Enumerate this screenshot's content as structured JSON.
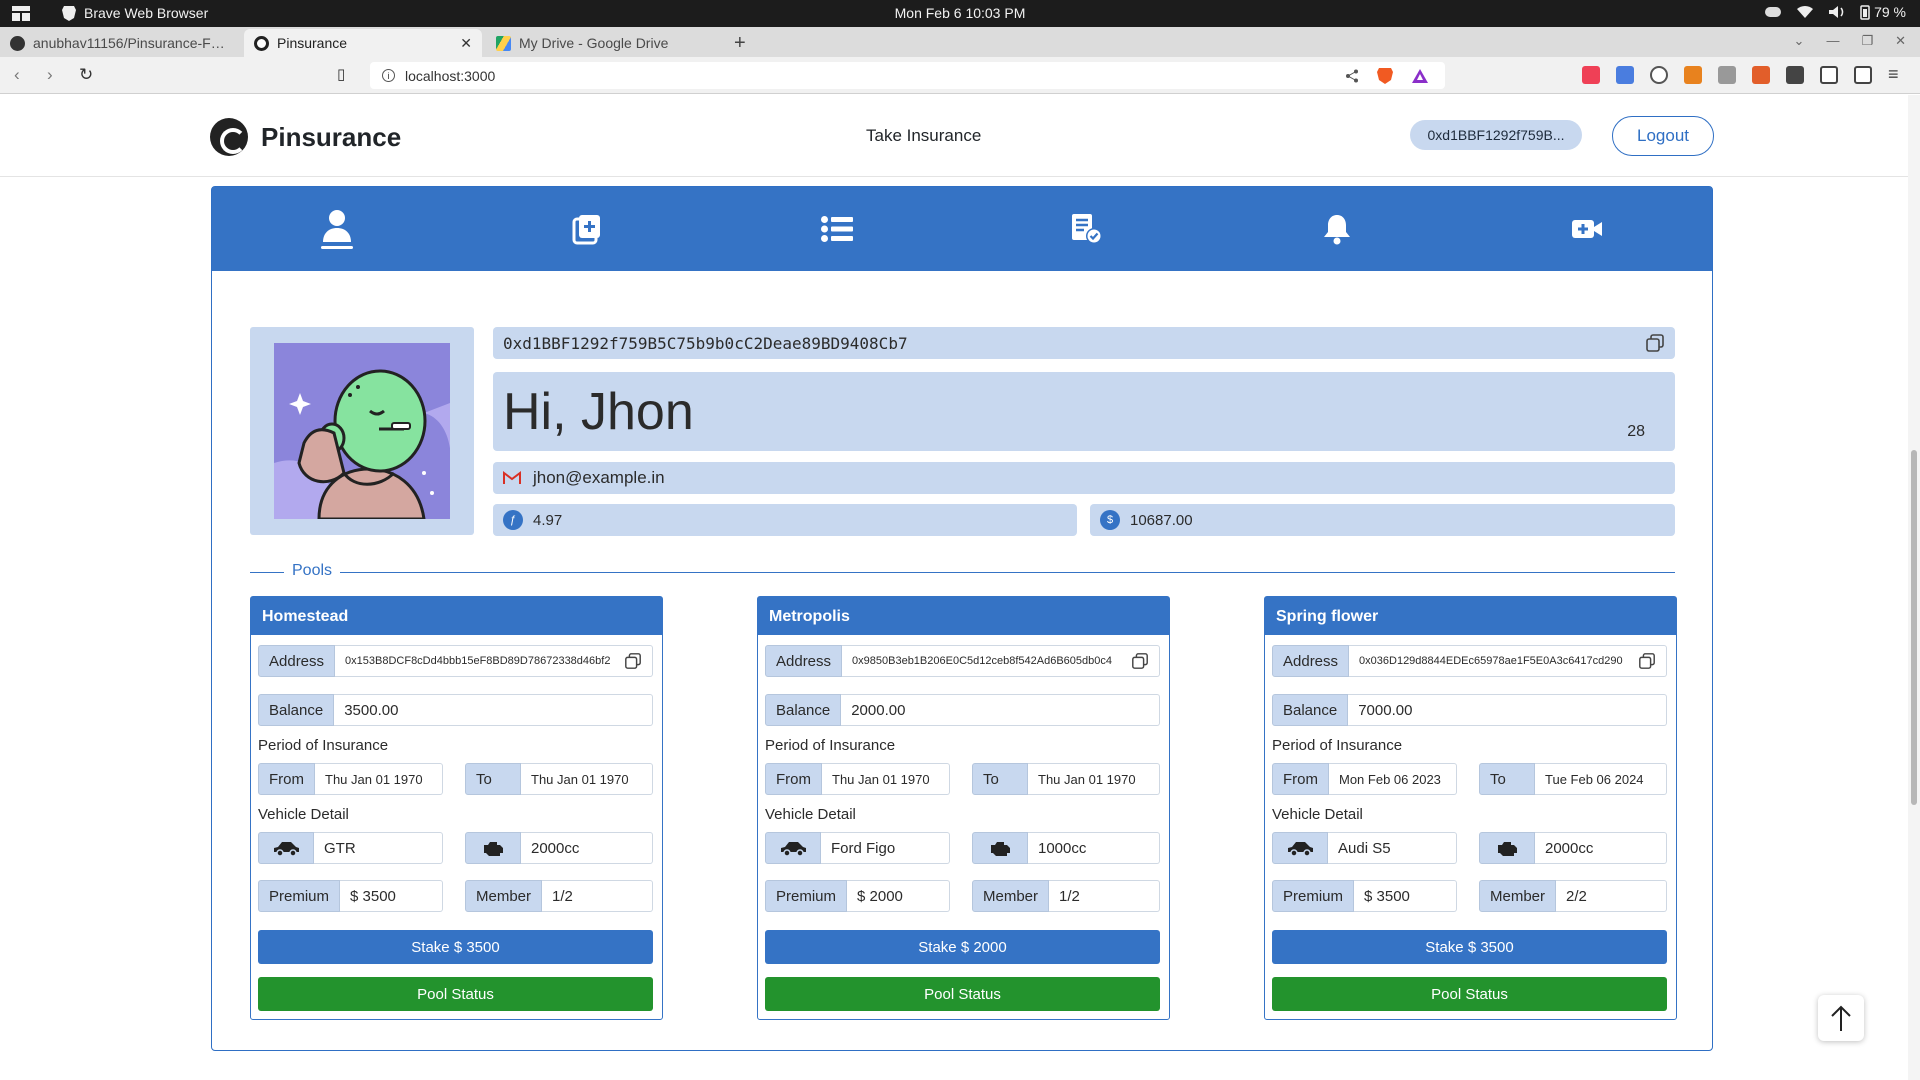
{
  "os": {
    "app_name": "Brave Web Browser",
    "clock": "Mon Feb 6  10:03 PM",
    "battery": "79 %"
  },
  "browser": {
    "tabs": [
      {
        "label": "anubhav11156/Pinsurance-F…",
        "active": false
      },
      {
        "label": "Pinsurance",
        "active": true
      },
      {
        "label": "My Drive - Google Drive",
        "active": false
      }
    ],
    "url": "localhost:3000"
  },
  "header": {
    "brand": "Pinsurance",
    "nav_link": "Take Insurance",
    "account_short": "0xd1BBF1292f759B...",
    "logout_label": "Logout"
  },
  "icon_nav": [
    {
      "name": "profile-icon",
      "active": true
    },
    {
      "name": "add-insurance-icon",
      "active": false
    },
    {
      "name": "list-icon",
      "active": false
    },
    {
      "name": "claims-icon",
      "active": false
    },
    {
      "name": "notification-bell-icon",
      "active": false
    },
    {
      "name": "video-call-icon",
      "active": false
    }
  ],
  "profile": {
    "address": "0xd1BBF1292f759B5C75b9b0cC2Deae89BD9408Cb7",
    "greeting": "Hi, Jhon",
    "age": "28",
    "email": "jhon@example.in",
    "eth_balance": "4.97",
    "token_balance": "10687.00"
  },
  "pools_title": "Pools",
  "labels": {
    "address": "Address",
    "balance": "Balance",
    "period": "Period of Insurance",
    "from": "From",
    "to": "To",
    "vehicle": "Vehicle Detail",
    "premium": "Premium",
    "member": "Member",
    "pool_status": "Pool Status"
  },
  "pools": [
    {
      "name": "Homestead",
      "address": "0x153B8DCF8cDd4bbb15eF8BD89D78672338d46bf2",
      "balance": "3500.00",
      "from": "Thu Jan 01 1970",
      "to": "Thu Jan 01 1970",
      "vehicle": "GTR",
      "engine": "2000cc",
      "premium": "$ 3500",
      "member": "1/2",
      "stake": "Stake $ 3500"
    },
    {
      "name": "Metropolis",
      "address": "0x9850B3eb1B206E0C5d12ceb8f542Ad6B605db0c4",
      "balance": "2000.00",
      "from": "Thu Jan 01 1970",
      "to": "Thu Jan 01 1970",
      "vehicle": "Ford Figo",
      "engine": "1000cc",
      "premium": "$ 2000",
      "member": "1/2",
      "stake": "Stake $ 2000"
    },
    {
      "name": "Spring flower",
      "address": "0x036D129d8844EDEc65978ae1F5E0A3c6417cd290",
      "balance": "7000.00",
      "from": "Mon Feb 06 2023",
      "to": "Tue Feb 06 2024",
      "vehicle": "Audi S5",
      "engine": "2000cc",
      "premium": "$ 3500",
      "member": "2/2",
      "stake": "Stake $ 3500"
    }
  ],
  "colors": {
    "primary": "#3573c5",
    "field": "#c8d8ef",
    "success": "#23932d"
  }
}
